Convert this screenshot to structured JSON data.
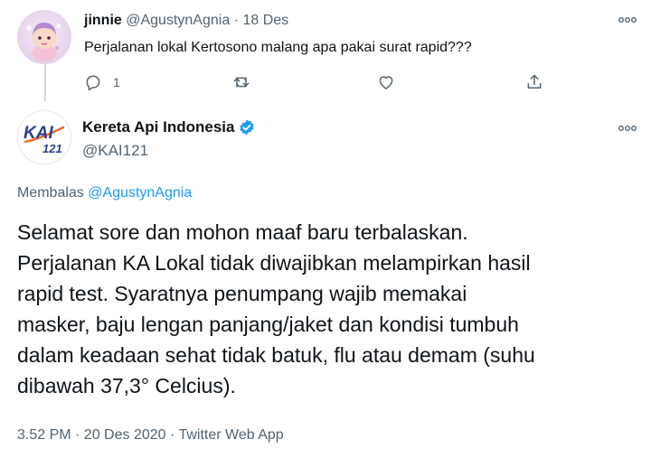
{
  "parent_tweet": {
    "display_name": "jinnie",
    "handle": "@AgustynAgnia",
    "separator": "·",
    "date": "18 Des",
    "text": "Perjalanan lokal Kertosono malang apa pakai surat rapid???",
    "reply_count": "1",
    "more_icon": "more-dots-icon"
  },
  "main_tweet": {
    "display_name": "Kereta Api Indonesia",
    "handle": "@KAI121",
    "avatar_logo_text": "KAI",
    "avatar_logo_sub": "121",
    "verified": true,
    "reply_prefix": "Membalas ",
    "reply_mention": "@AgustynAgnia",
    "body_lines": [
      "Selamat sore dan mohon maaf baru terbalaskan.",
      "Perjalanan KA Lokal tidak diwajibkan melampirkan hasil",
      "rapid test. Syaratnya penumpang wajib memakai",
      "masker, baju lengan panjang/jaket dan kondisi tumbuh",
      "dalam keadaan sehat tidak batuk, flu atau demam (suhu",
      "dibawah 37,3° Celcius)."
    ],
    "meta": "3.52 PM · 20 Des 2020 · Twitter Web App"
  },
  "colors": {
    "text_primary": "#0f1419",
    "text_secondary": "#536471",
    "accent": "#1d9bf0",
    "kai_blue": "#2a3f8f",
    "kai_orange": "#f26722"
  }
}
